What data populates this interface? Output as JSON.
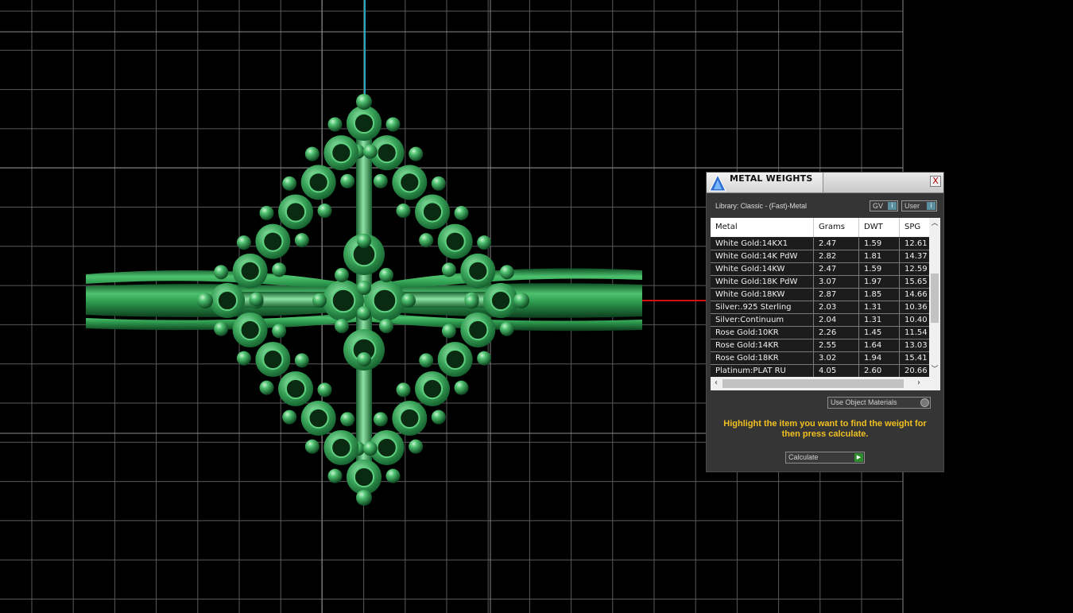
{
  "panel": {
    "title": "METAL WEIGHTS",
    "close_label": "X",
    "library_label": "Library: Classic - (Fast)-Metal",
    "toggle_gv_label": "GV",
    "toggle_user_label": "User",
    "use_object_materials_label": "Use Object Materials",
    "instruction": "Highlight the item you want to find the weight for then press calculate.",
    "calculate_label": "Calculate",
    "columns": [
      "Metal",
      "Grams",
      "DWT",
      "SPG"
    ],
    "rows": [
      {
        "metal": "White Gold:14KX1",
        "grams": "2.47",
        "dwt": "1.59",
        "spg": "12.61"
      },
      {
        "metal": "White Gold:14K PdW",
        "grams": "2.82",
        "dwt": "1.81",
        "spg": "14.37"
      },
      {
        "metal": "White Gold:14KW",
        "grams": "2.47",
        "dwt": "1.59",
        "spg": "12.59"
      },
      {
        "metal": "White Gold:18K PdW",
        "grams": "3.07",
        "dwt": "1.97",
        "spg": "15.65"
      },
      {
        "metal": "White Gold:18KW",
        "grams": "2.87",
        "dwt": "1.85",
        "spg": "14.66"
      },
      {
        "metal": "Silver:.925 Sterling",
        "grams": "2.03",
        "dwt": "1.31",
        "spg": "10.36"
      },
      {
        "metal": "Silver:Continuum",
        "grams": "2.04",
        "dwt": "1.31",
        "spg": "10.40"
      },
      {
        "metal": "Rose Gold:10KR",
        "grams": "2.26",
        "dwt": "1.45",
        "spg": "11.54"
      },
      {
        "metal": "Rose Gold:14KR",
        "grams": "2.55",
        "dwt": "1.64",
        "spg": "13.03"
      },
      {
        "metal": "Rose Gold:18KR",
        "grams": "3.02",
        "dwt": "1.94",
        "spg": "15.41"
      },
      {
        "metal": "Platinum:PLAT RU",
        "grams": "4.05",
        "dwt": "2.60",
        "spg": "20.66"
      }
    ]
  },
  "viewport": {
    "background": "#000000",
    "grid_color": "#5a5a5a",
    "model_color": "#3fae5f",
    "axis_y_color": "#1fa8c0",
    "axis_x_color": "#d01010"
  }
}
